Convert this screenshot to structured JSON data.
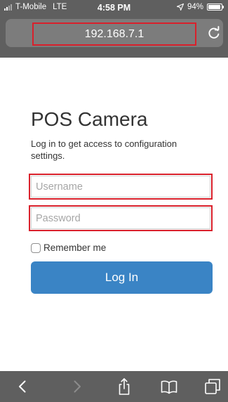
{
  "status_bar": {
    "carrier": "T-Mobile",
    "network": "LTE",
    "time": "4:58 PM",
    "battery_percent": "94%",
    "battery_level": 0.94,
    "icons": [
      "signal-icon",
      "location-arrow-icon",
      "battery-icon"
    ]
  },
  "browser": {
    "url": "192.168.7.1",
    "toolbar_icons": [
      "back-icon",
      "forward-icon",
      "share-icon",
      "bookmarks-icon",
      "tabs-icon"
    ],
    "reload_icon": "reload-icon",
    "chrome_color": "#5f5f5f"
  },
  "login": {
    "title": "POS Camera",
    "subtitle": "Log in to get access to configuration settings.",
    "username_placeholder": "Username",
    "password_placeholder": "Password",
    "remember_label": "Remember me",
    "remember_checked": false,
    "submit_label": "Log In",
    "accent_color": "#3a84c5",
    "highlight_color": "#d9202b"
  }
}
